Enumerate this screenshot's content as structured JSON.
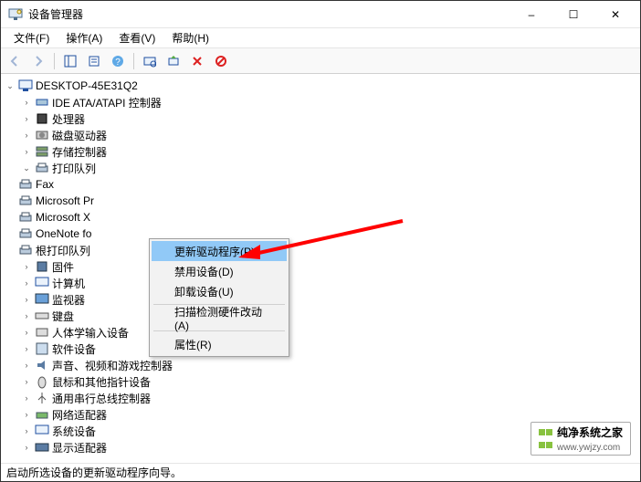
{
  "window": {
    "title": "设备管理器",
    "min_label": "–",
    "max_label": "☐",
    "close_label": "✕"
  },
  "menubar": {
    "file": "文件(F)",
    "action": "操作(A)",
    "view": "查看(V)",
    "help": "帮助(H)"
  },
  "tree": {
    "root": "DESKTOP-45E31Q2",
    "ide": "IDE ATA/ATAPI 控制器",
    "cpu": "处理器",
    "diskdrv": "磁盘驱动器",
    "storage": "存储控制器",
    "printq": "打印队列",
    "fax": "Fax",
    "msprint": "Microsoft Pr",
    "msxps": "Microsoft X",
    "onenote": "OneNote fo",
    "rootprint": "根打印队列",
    "firmware": "固件",
    "computer": "计算机",
    "monitor": "监视器",
    "keyboard": "键盘",
    "hid": "人体学输入设备",
    "software": "软件设备",
    "sound": "声音、视频和游戏控制器",
    "mouse": "鼠标和其他指针设备",
    "usb": "通用串行总线控制器",
    "network": "网络适配器",
    "system": "系统设备",
    "display": "显示适配器"
  },
  "context_menu": {
    "update": "更新驱动程序(P)",
    "disable": "禁用设备(D)",
    "uninstall": "卸载设备(U)",
    "scan": "扫描检测硬件改动(A)",
    "properties": "属性(R)"
  },
  "statusbar": {
    "text": "启动所选设备的更新驱动程序向导。"
  },
  "watermark": {
    "name": "纯净系统之家",
    "url": "www.ywjzy.com"
  },
  "colors": {
    "highlight": "#91c9f7",
    "arrow": "#ff0000",
    "wm_green": "#88c23f"
  }
}
